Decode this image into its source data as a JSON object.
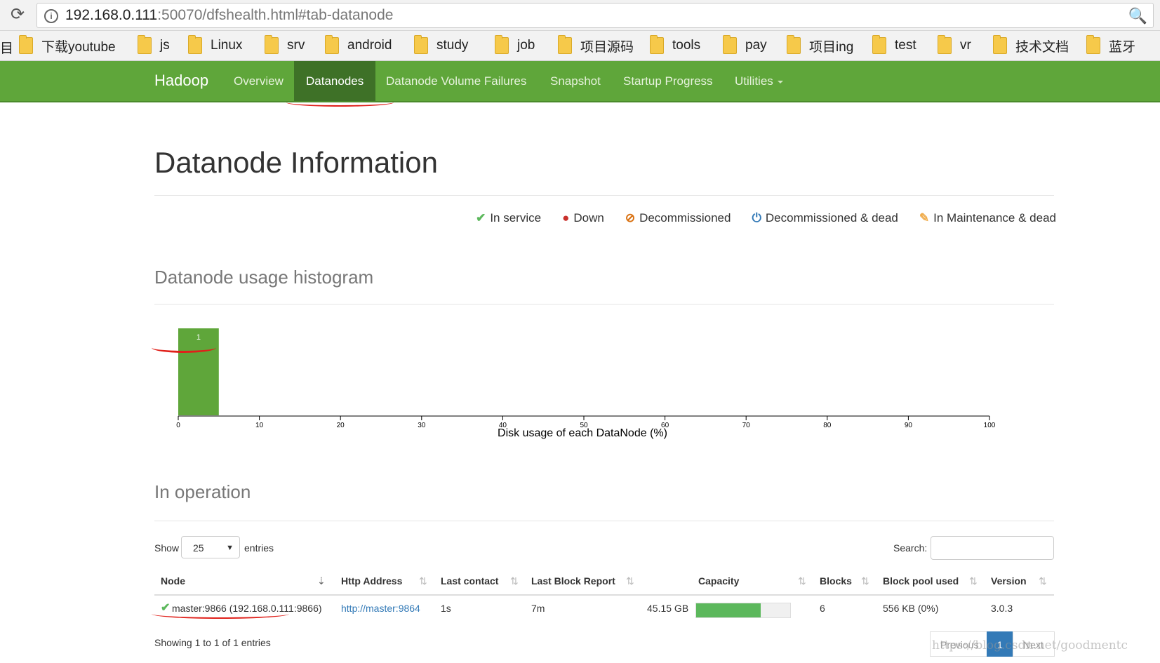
{
  "browser": {
    "url_host": "192.168.0.111",
    "url_rest": ":50070/dfshealth.html#tab-datanode",
    "bookmarks": [
      "下载youtube",
      "js",
      "Linux",
      "srv",
      "android",
      "study",
      "job",
      "项目源码",
      "tools",
      "pay",
      "项目ing",
      "test",
      "vr",
      "技术文档",
      "蓝牙"
    ],
    "bookmark_cut": "目"
  },
  "navbar": {
    "brand": "Hadoop",
    "items": [
      "Overview",
      "Datanodes",
      "Datanode Volume Failures",
      "Snapshot",
      "Startup Progress",
      "Utilities"
    ],
    "active": "Datanodes"
  },
  "page": {
    "title": "Datanode Information",
    "legend": [
      {
        "icon": "check-icon",
        "label": "In service",
        "color": "#5cb85c",
        "glyph": "✔"
      },
      {
        "icon": "exclamation-circle-icon",
        "label": "Down",
        "color": "#c9302c",
        "glyph": "❗"
      },
      {
        "icon": "ban-icon",
        "label": "Decommissioned",
        "color": "#d9700f",
        "glyph": "⊘"
      },
      {
        "icon": "power-icon",
        "label": "Decommissioned & dead",
        "color": "#337ab7",
        "glyph": "⏻"
      },
      {
        "icon": "wrench-icon",
        "label": "In Maintenance & dead",
        "color": "#f0ad4e",
        "glyph": "🔧"
      }
    ],
    "histogram_title": "Datanode usage histogram",
    "operation_title": "In operation"
  },
  "chart_data": {
    "type": "bar",
    "xlabel": "Disk usage of each DataNode (%)",
    "x_ticks": [
      0,
      10,
      20,
      30,
      40,
      50,
      60,
      70,
      80,
      90,
      100
    ],
    "xlim": [
      0,
      100
    ],
    "bins": [
      {
        "x0": 0,
        "x1": 5,
        "count": 1
      }
    ],
    "bar_label": "1",
    "bar_color": "#5fa63a"
  },
  "table": {
    "show_label": "Show",
    "page_size": "25",
    "entries_label": "entries",
    "search_label": "Search:",
    "headers": [
      "Node",
      "Http Address",
      "Last contact",
      "Last Block Report",
      "Capacity",
      "Blocks",
      "Block pool used",
      "Version"
    ],
    "rows": [
      {
        "node": "master:9866 (192.168.0.111:9866)",
        "http": "http://master:9864",
        "last_contact": "1s",
        "last_block_report": "7m",
        "capacity": "45.15 GB",
        "capacity_used_fraction": 0.69,
        "blocks": "6",
        "block_pool_used": "556 KB (0%)",
        "version": "3.0.3"
      }
    ],
    "showing": "Showing 1 to 1 of 1 entries",
    "pager": [
      "Previous",
      "1",
      "Next"
    ]
  },
  "watermark": "https://blog.csdn.net/goodmentc"
}
